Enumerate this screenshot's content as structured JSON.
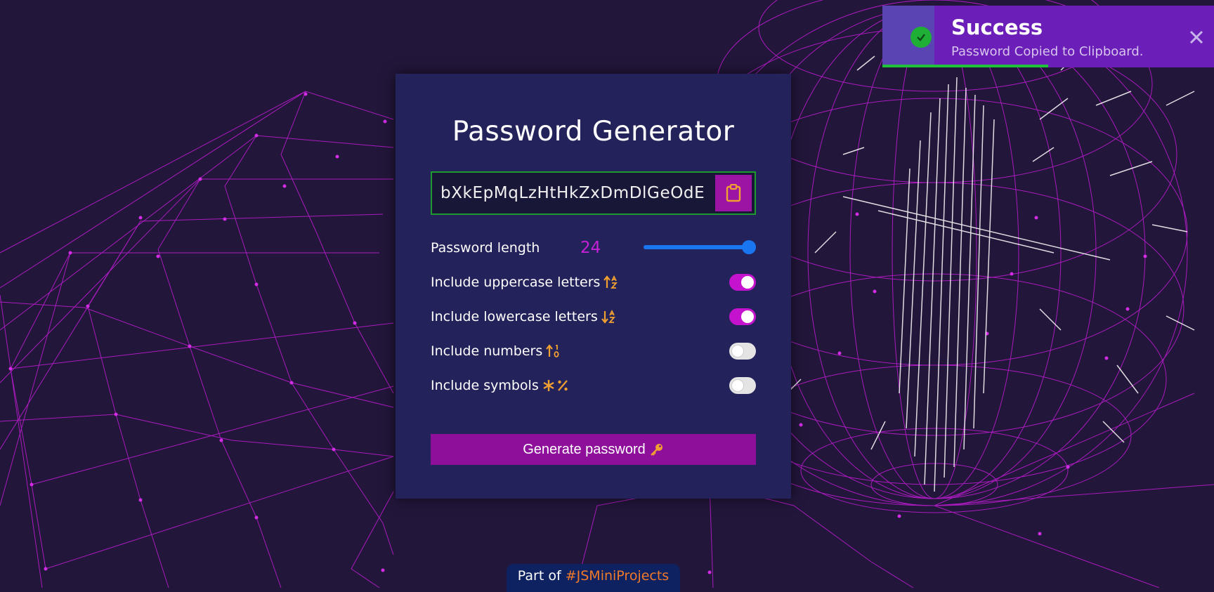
{
  "app": {
    "title": "Password Generator"
  },
  "password": {
    "value": "bXkEpMqLzHtHkZxDmDlGeOdE",
    "copy_icon": "clipboard-icon"
  },
  "options": {
    "length_label": "Password length",
    "length_value": "24",
    "length_fraction": 1.0,
    "uppercase_label": "Include uppercase letters",
    "uppercase_icon": "sort-alpha-up-icon",
    "uppercase_on": true,
    "lowercase_label": "Include lowercase letters",
    "lowercase_icon": "sort-alpha-down-icon",
    "lowercase_on": true,
    "numbers_label": "Include numbers",
    "numbers_icon": "sort-numeric-up-icon",
    "numbers_on": false,
    "symbols_label": "Include symbols",
    "symbols_icon": "asterisk-percent-icon",
    "symbols_on": false
  },
  "generate": {
    "label": "Generate password",
    "icon": "key-icon"
  },
  "toast": {
    "title": "Success",
    "message": "Password Copied to Clipboard.",
    "icon": "check-circle-icon",
    "close_icon": "close-icon",
    "progress": 0.5
  },
  "footer": {
    "prefix": "Part of",
    "tag": "#JSMiniProjects"
  },
  "colors": {
    "background": "#22163a",
    "card": "#24225a",
    "accent": "#c512ce",
    "button": "#8d0f9a",
    "icon_orange": "#f0a030",
    "wireframe": "#c21ad6",
    "toast": "#6b1eb8",
    "success": "#1fae36",
    "slider": "#1976f0"
  }
}
